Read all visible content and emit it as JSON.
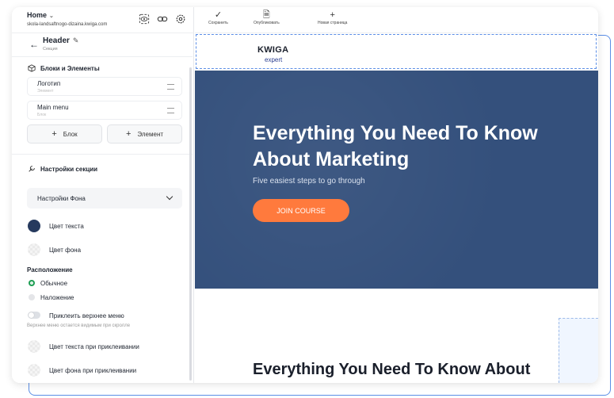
{
  "app": {
    "page_selector": "Home",
    "site_url": "skola-landsaftnogo-dizaina.kwiga.com"
  },
  "toolbar": {
    "save": "Сохранить",
    "publish": "Опубликовать",
    "new_page": "Новая страница"
  },
  "section": {
    "title": "Header",
    "subtitle": "Секция"
  },
  "blocks": {
    "heading": "Блоки и Элементы",
    "items": [
      {
        "title": "Логотип",
        "type": "Элемент"
      },
      {
        "title": "Main menu",
        "type": "Блок"
      }
    ],
    "add_block": "Блок",
    "add_element": "Элемент"
  },
  "settings": {
    "heading": "Настройки секции",
    "bg_dropdown": "Настройки Фона",
    "text_color_label": "Цвет текста",
    "text_color": "#263a5e",
    "bg_color_label": "Цвет фона",
    "position_heading": "Расположение",
    "position_options": [
      "Обычное",
      "Наложение"
    ],
    "sticky_label": "Приклеить верхнее меню",
    "sticky_hint": "Верхнее меню остается видимым при скролле",
    "sticky_text_color_label": "Цвет текста при приклеивании",
    "sticky_bg_color_label": "Цвет фона при приклеивании"
  },
  "canvas": {
    "logo_top": "KWIGA",
    "logo_bottom": "expert",
    "hero_title": "Everything You Need To Know About Marketing",
    "hero_subtitle": "Five easiest steps to go through",
    "hero_button": "JOIN COURSE",
    "section2_title": "Everything You Need To Know About Marketing"
  },
  "colors": {
    "accent": "#ff7a3d",
    "hero_bg": "#34507c",
    "selection": "#5b8ee6",
    "radio_active": "#1f9e54"
  }
}
